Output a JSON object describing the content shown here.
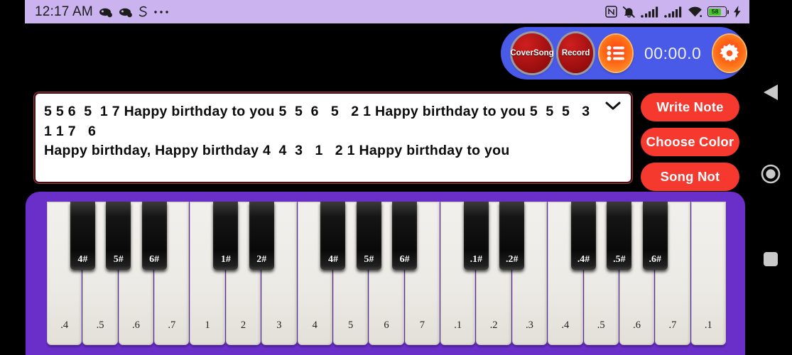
{
  "statusbar": {
    "time": "12:17 AM",
    "left_icons": [
      "game-controller-icon",
      "game-controller-icon",
      "s-app-icon",
      "overflow-dots-icon"
    ],
    "right_icons": [
      "nfc-icon",
      "mute-vibrate-icon",
      "signal-bars-icon",
      "signal-bars-icon",
      "wifi-icon",
      "battery-icon",
      "charging-bolt-icon"
    ],
    "battery_percent": "58",
    "bar_color": "#cbb3f0"
  },
  "toolbar": {
    "background": "#4a5ae8",
    "cover_song_label": "Cover\nSong",
    "cover_song_line1": "Cover",
    "cover_song_line2": "Song",
    "record_label": "Record",
    "list_icon": "list-icon",
    "timer": "00:00.0",
    "settings_icon": "gear-icon",
    "button_red": "#a51111",
    "button_orange": "#ff6a15"
  },
  "note_panel": {
    "text": "5 5 6  5  1 7 Happy birthday to you 5  5  6   5   2 1 Happy birthday to you 5  5  5   3   1 1 7   6\nHappy birthday, Happy birthday 4  4  3   1   2 1 Happy birthday to you",
    "dropdown_icon": "chevron-down-icon",
    "border_color": "#4a0d12"
  },
  "side_buttons": [
    {
      "label": "Write Note",
      "name": "write-note-button"
    },
    {
      "label": "Choose Color",
      "name": "choose-color-button"
    },
    {
      "label": "Song Not",
      "name": "song-not-button"
    }
  ],
  "side_button_color": "#f5392e",
  "piano": {
    "frame_color": "#6a2fc8",
    "white_keys": [
      ".4",
      ".5",
      ".6",
      ".7",
      "1",
      "2",
      "3",
      "4",
      "5",
      "6",
      "7",
      ".1",
      ".2",
      ".3",
      ".4",
      ".5",
      ".6",
      ".7",
      ".1"
    ],
    "black_keys": [
      {
        "label": "4#",
        "after_white_index": 0
      },
      {
        "label": "5#",
        "after_white_index": 1
      },
      {
        "label": "6#",
        "after_white_index": 2
      },
      {
        "label": "1#",
        "after_white_index": 4
      },
      {
        "label": "2#",
        "after_white_index": 5
      },
      {
        "label": "4#",
        "after_white_index": 7
      },
      {
        "label": "5#",
        "after_white_index": 8
      },
      {
        "label": "6#",
        "after_white_index": 9
      },
      {
        "label": ".1#",
        "after_white_index": 11
      },
      {
        "label": ".2#",
        "after_white_index": 12
      },
      {
        "label": ".4#",
        "after_white_index": 14
      },
      {
        "label": ".5#",
        "after_white_index": 15
      },
      {
        "label": ".6#",
        "after_white_index": 16
      }
    ]
  },
  "navbar": {
    "back_icon": "back-triangle-icon",
    "home_icon": "home-circle-icon",
    "recents_icon": "recents-square-icon"
  }
}
